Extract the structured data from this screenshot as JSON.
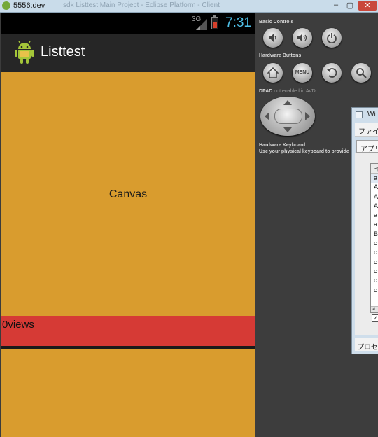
{
  "titlebar": {
    "title": "5556:dev",
    "background_text": "sdk Listtest Main Project - Eclipse Platform - Client",
    "minimize": "–",
    "maximize": "▢",
    "close": "✕"
  },
  "status_bar": {
    "network": "3G",
    "time": "7:31",
    "battery_color": "#d6402b",
    "time_color": "#4fc1e9"
  },
  "action_bar": {
    "app_icon": "android-robot-icon",
    "title": "Listtest"
  },
  "canvas": {
    "label": "Canvas",
    "background": "#d99c2e"
  },
  "list_item": {
    "text": "0views",
    "background": "#d63a35"
  },
  "controls": {
    "basic_controls_label": "Basic Controls",
    "hardware_buttons_label": "Hardware Buttons",
    "dpad_label": "DPAD",
    "dpad_note": "not enabled in AVD",
    "keyboard_label": "Hardware Keyboard",
    "keyboard_note": "Use your physical keyboard to provide input",
    "buttons": {
      "volume_down": "volume-down-icon",
      "volume_up": "volume-up-icon",
      "power": "power-icon",
      "home": "home-icon",
      "menu": "MENU",
      "back": "back-icon",
      "search": "search-icon"
    }
  },
  "side_window": {
    "title": "Wi",
    "menu": "ファイ",
    "tab": "アプリ",
    "list_header": "イ",
    "list_rows": [
      "a",
      "A",
      "A",
      "A",
      "a",
      "a",
      "B",
      "c",
      "c",
      "c",
      "c",
      "c",
      "c"
    ],
    "scroll_indicator": "◂",
    "checkbox": "✓",
    "statusbar": "プロセ"
  }
}
